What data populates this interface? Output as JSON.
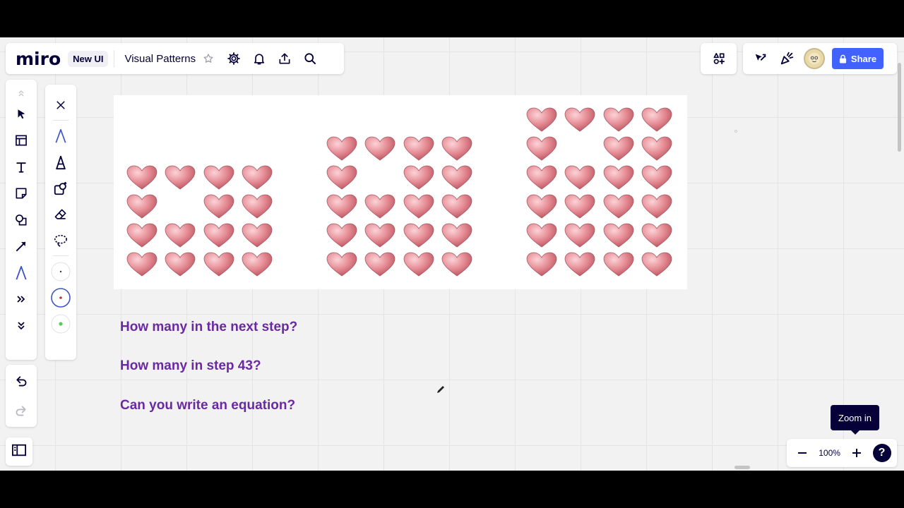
{
  "app": {
    "logo": "miro",
    "ui_badge": "New UI",
    "board_title": "Visual Patterns"
  },
  "topbar_right": {
    "share_label": "Share"
  },
  "zoom": {
    "value": "100%",
    "tooltip": "Zoom in"
  },
  "canvas": {
    "questions": [
      "How many in the next step?",
      "How many in step 43?",
      "Can you write an equation?"
    ],
    "heart_patterns": [
      {
        "step": 1,
        "rows": 4,
        "cols": 4,
        "missing": [
          [
            1,
            1
          ]
        ]
      },
      {
        "step": 2,
        "rows": 5,
        "cols": 4,
        "missing": [
          [
            1,
            1
          ]
        ]
      },
      {
        "step": 3,
        "rows": 6,
        "cols": 4,
        "missing": [
          [
            1,
            1
          ]
        ]
      }
    ]
  },
  "colors": {
    "accent": "#4262ff",
    "question_text": "#6a29a2",
    "heart": "#e58a93",
    "pen_active": "#3d55c9"
  },
  "pen_colors": [
    "#3a3a3a",
    "#c0392b",
    "#5ec95e"
  ]
}
